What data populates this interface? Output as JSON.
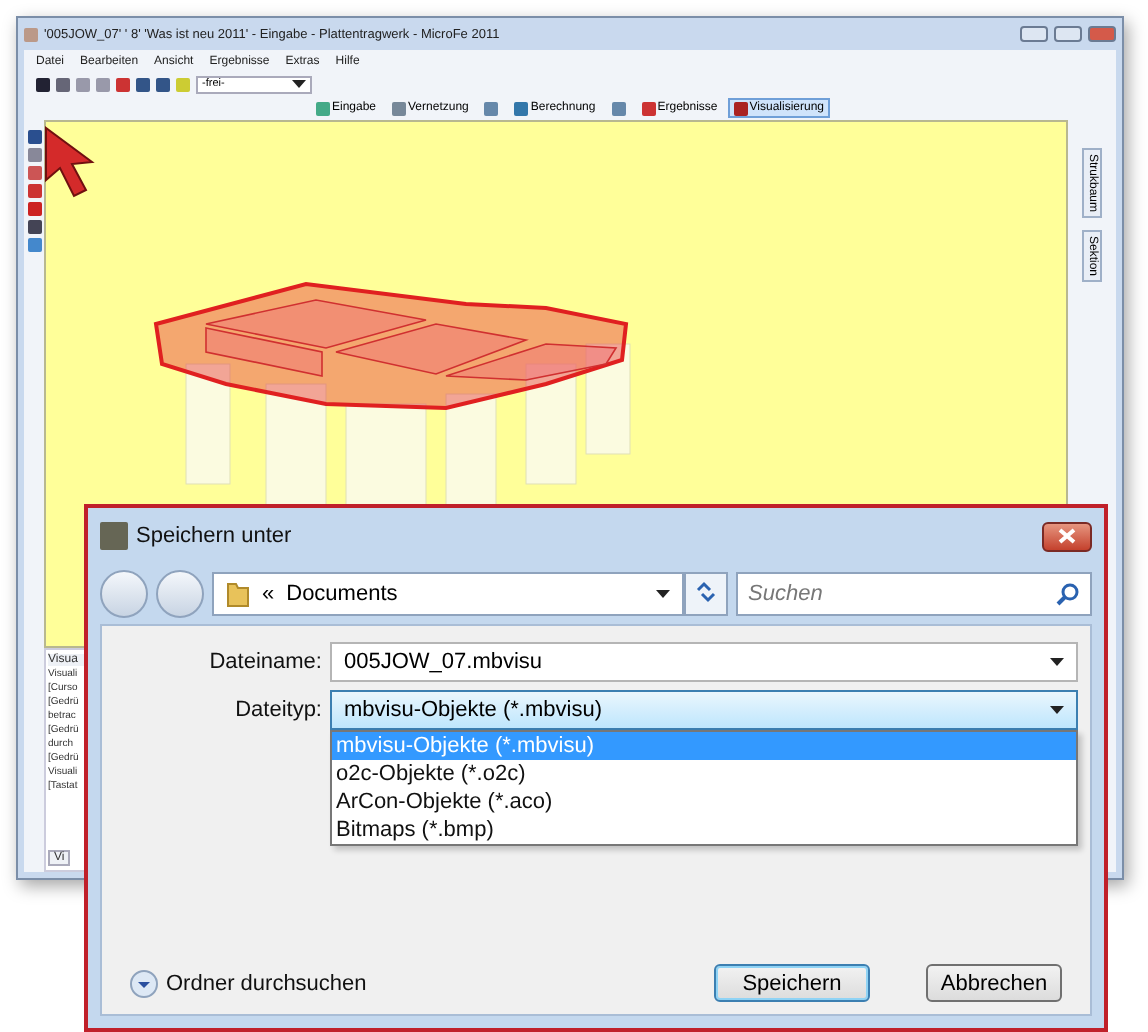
{
  "app_window": {
    "title": "'005JOW_07' ' 8' 'Was ist neu 2011' - Eingabe - Plattentragwerk - MicroFe 2011",
    "menu": [
      "Datei",
      "Bearbeiten",
      "Ansicht",
      "Ergebnisse",
      "Extras",
      "Hilfe"
    ],
    "style_combo": "-frei-",
    "mode_tabs": [
      {
        "kind": "text",
        "label": "Eingabe",
        "selected": false
      },
      {
        "kind": "text",
        "label": "Vernetzung",
        "selected": false
      },
      {
        "kind": "icon",
        "selected": false
      },
      {
        "kind": "text",
        "label": "Berechnung",
        "selected": false
      },
      {
        "kind": "icon",
        "selected": false
      },
      {
        "kind": "text",
        "label": "Ergebnisse",
        "selected": false
      },
      {
        "kind": "text",
        "label": "Visualisierung",
        "selected": true
      }
    ],
    "side_tabs": [
      "Strukbaum",
      "Sektion"
    ],
    "log_panel": {
      "heading": "Visua",
      "lines": [
        "Visuali",
        "[Curso",
        "[Gedrü",
        "betrac",
        "[Gedrü",
        "durch",
        "[Gedrü",
        "Visuali",
        "[Tastat"
      ],
      "tab": "Vi"
    }
  },
  "dialog": {
    "title": "Speichern unter",
    "path_prefix": "«",
    "folder": "Documents",
    "search": {
      "placeholder": "Suchen"
    },
    "fields": [
      {
        "kind": "text",
        "label": "Dateiname:",
        "value": "005JOW_07.mbvisu",
        "focused": false
      },
      {
        "kind": "select",
        "label": "Dateityp:",
        "value": "mbvisu-Objekte (*.mbvisu)",
        "focused": true
      }
    ],
    "file_types": [
      {
        "label": "mbvisu-Objekte (*.mbvisu)",
        "selected": true
      },
      {
        "label": "o2c-Objekte (*.o2c)",
        "selected": false
      },
      {
        "label": "ArCon-Objekte (*.aco)",
        "selected": false
      },
      {
        "label": "Bitmaps (*.bmp)",
        "selected": false
      }
    ],
    "browse_folders": "Ordner durchsuchen",
    "buttons": [
      {
        "label": "Speichern",
        "default": true
      },
      {
        "label": "Abbrechen",
        "default": false
      }
    ]
  }
}
